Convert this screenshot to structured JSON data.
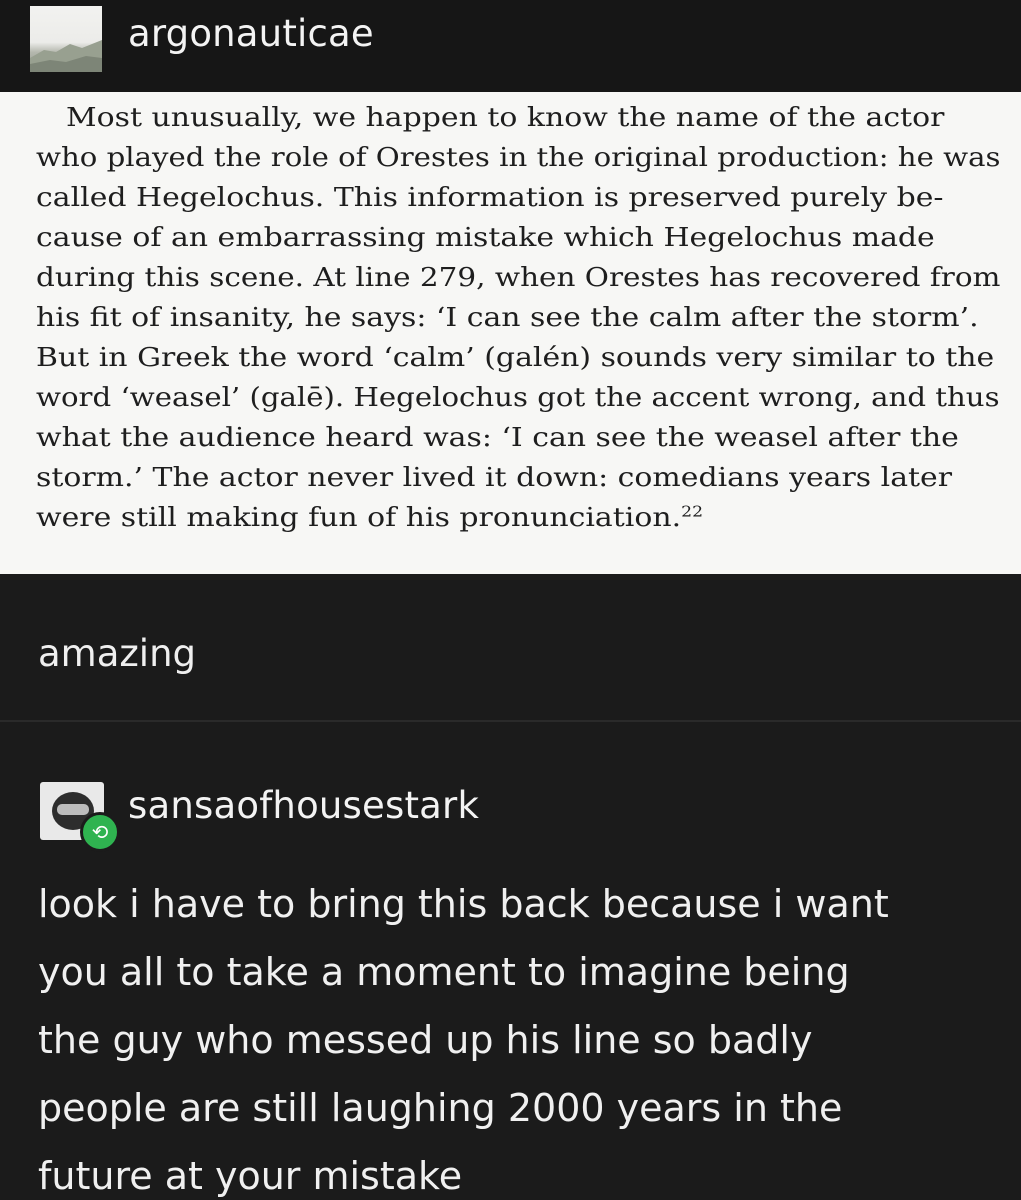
{
  "post": {
    "original_author": "argonauticae",
    "excerpt_lines": [
      "Most unusually, we happen to know the name of the actor",
      "who played the role of Orestes in the original production: he was",
      "called Hegelochus. This information is preserved purely be-",
      "cause of an embarrassing mistake which Hegelochus made",
      "during this scene. At line 279, when Orestes has recovered from",
      "his fit of insanity, he says: ‘I can see the calm after the storm’.",
      "But in Greek the word ‘calm’ (galén) sounds very similar to the",
      "word ‘weasel’ (galē). Hegelochus got the accent wrong, and thus",
      "what the audience heard was: ‘I can see the weasel after the",
      "storm.’ The actor never lived it down: comedians years later",
      "were still making fun of his pronunciation."
    ],
    "footnote_number": "22",
    "comment": "amazing"
  },
  "reblog": {
    "author": "sansaofhousestark",
    "badge_icon": "reblog-icon",
    "badge_color": "#2fb350",
    "body_lines": [
      "look i have to bring this back because i want",
      "you all to take a moment to imagine being",
      "the guy who messed up his line so badly",
      "people are still laughing 2000 years in the",
      "future at your mistake"
    ]
  }
}
